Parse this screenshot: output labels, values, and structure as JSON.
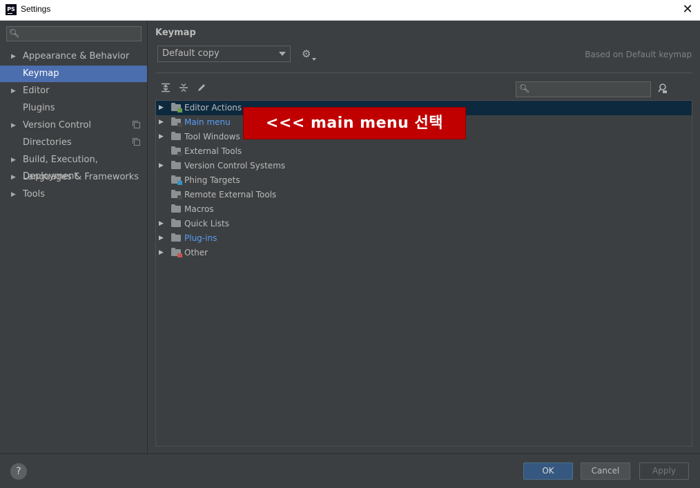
{
  "window": {
    "title": "Settings",
    "app_icon": "PS"
  },
  "sidebar": {
    "search_placeholder": "",
    "items": [
      {
        "label": "Appearance & Behavior",
        "expandable": true,
        "selected": false
      },
      {
        "label": "Keymap",
        "expandable": false,
        "selected": true
      },
      {
        "label": "Editor",
        "expandable": true,
        "selected": false
      },
      {
        "label": "Plugins",
        "expandable": false,
        "selected": false
      },
      {
        "label": "Version Control",
        "expandable": true,
        "selected": false,
        "project_icon": true
      },
      {
        "label": "Directories",
        "expandable": false,
        "selected": false,
        "project_icon": true
      },
      {
        "label": "Build, Execution, Deployment",
        "expandable": true,
        "selected": false
      },
      {
        "label": "Languages & Frameworks",
        "expandable": true,
        "selected": false
      },
      {
        "label": "Tools",
        "expandable": true,
        "selected": false
      }
    ]
  },
  "main": {
    "title": "Keymap",
    "keymap_select": {
      "value": "Default copy"
    },
    "based_on": "Based on Default keymap",
    "toolbar": {
      "expand_all_icon": "expand-all-icon",
      "collapse_all_icon": "collapse-all-icon",
      "edit_icon": "pencil-icon"
    },
    "search_placeholder": "",
    "tree": [
      {
        "label": "Editor Actions",
        "expandable": true,
        "selected": true,
        "link": false,
        "icon": "editor-actions-folder-icon"
      },
      {
        "label": "Main menu",
        "expandable": true,
        "selected": false,
        "link": true,
        "icon": "main-menu-folder-icon"
      },
      {
        "label": "Tool Windows",
        "expandable": true,
        "selected": false,
        "link": false,
        "icon": "folder-icon"
      },
      {
        "label": "External Tools",
        "expandable": false,
        "selected": false,
        "link": false,
        "icon": "external-tools-folder-icon"
      },
      {
        "label": "Version Control Systems",
        "expandable": true,
        "selected": false,
        "link": false,
        "icon": "folder-icon"
      },
      {
        "label": "Phing Targets",
        "expandable": false,
        "selected": false,
        "link": false,
        "icon": "phing-folder-icon"
      },
      {
        "label": "Remote External Tools",
        "expandable": false,
        "selected": false,
        "link": false,
        "icon": "remote-tools-folder-icon"
      },
      {
        "label": "Macros",
        "expandable": false,
        "selected": false,
        "link": false,
        "icon": "folder-icon"
      },
      {
        "label": "Quick Lists",
        "expandable": true,
        "selected": false,
        "link": false,
        "icon": "folder-icon"
      },
      {
        "label": "Plug-ins",
        "expandable": true,
        "selected": false,
        "link": true,
        "icon": "folder-icon"
      },
      {
        "label": "Other",
        "expandable": true,
        "selected": false,
        "link": false,
        "icon": "other-folder-icon"
      }
    ]
  },
  "annotation": {
    "text": "<<< main menu 선택",
    "color": "#c00000"
  },
  "footer": {
    "help": "?",
    "ok": "OK",
    "cancel": "Cancel",
    "apply": "Apply"
  },
  "colors": {
    "selection": "#4b6eaf",
    "tree_selection": "#0d293e",
    "link": "#589df6",
    "ok_button": "#365880"
  }
}
